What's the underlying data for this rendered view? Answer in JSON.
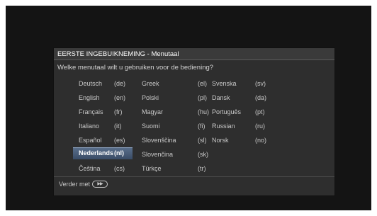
{
  "dialog": {
    "title": "EERSTE INGEBUIKNEMING - Menutaal",
    "question": "Welke menutaal wilt u gebruiken voor de bediening?",
    "footer_label": "Verder met",
    "footer_icon": "fast-forward-icon"
  },
  "languages": {
    "col1": [
      {
        "name": "Deutsch",
        "code": "(de)"
      },
      {
        "name": "English",
        "code": "(en)"
      },
      {
        "name": "Français",
        "code": "(fr)"
      },
      {
        "name": "Italiano",
        "code": "(it)"
      },
      {
        "name": "Español",
        "code": "(es)"
      },
      {
        "name": "Nederlands",
        "code": "(nl)",
        "selected": true
      },
      {
        "name": "Čeština",
        "code": "(cs)"
      }
    ],
    "col2": [
      {
        "name": "Greek",
        "code": "(el)"
      },
      {
        "name": "Polski",
        "code": "(pl)"
      },
      {
        "name": "Magyar",
        "code": "(hu)"
      },
      {
        "name": "Suomi",
        "code": "(fi)"
      },
      {
        "name": "Slovenščina",
        "code": "(sl)"
      },
      {
        "name": "Slovenčina",
        "code": "(sk)"
      },
      {
        "name": "Türkçe",
        "code": "(tr)"
      }
    ],
    "col3": [
      {
        "name": "Svenska",
        "code": "(sv)"
      },
      {
        "name": "Dansk",
        "code": "(da)"
      },
      {
        "name": "Português",
        "code": "(pt)"
      },
      {
        "name": "Russian",
        "code": "(ru)"
      },
      {
        "name": "Norsk",
        "code": "(no)"
      }
    ]
  },
  "colors": {
    "selection": "#4a5f7e",
    "background": "#141414",
    "dialog": "#2e2e2e"
  }
}
